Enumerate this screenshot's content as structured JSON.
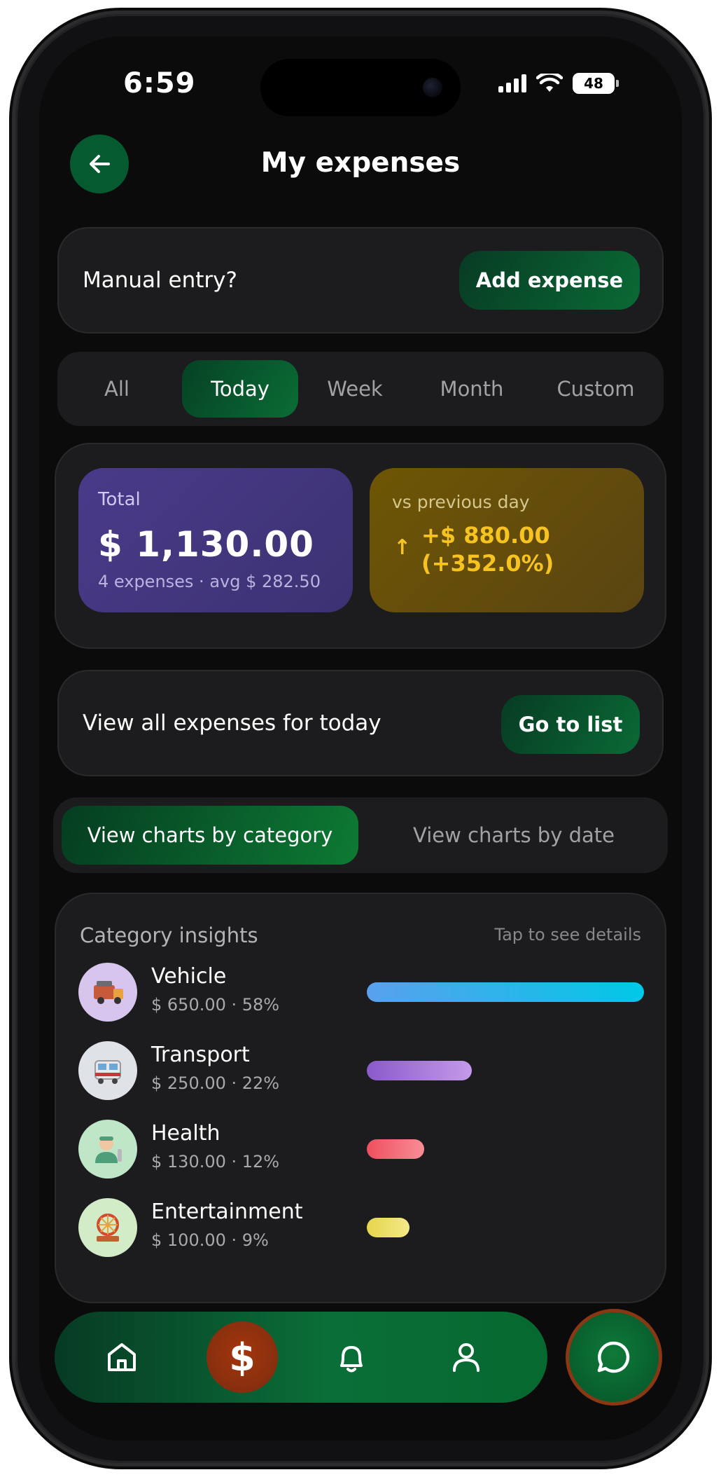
{
  "status_bar": {
    "time": "6:59",
    "battery": "48"
  },
  "header": {
    "title": "My expenses"
  },
  "manual_entry": {
    "label": "Manual entry?",
    "button": "Add expense"
  },
  "periods": {
    "items": [
      "All",
      "Today",
      "Week",
      "Month",
      "Custom"
    ],
    "selected": "Today"
  },
  "summary": {
    "total_label": "Total",
    "total_value": "$ 1,130.00",
    "total_meta": "4 expenses · avg $ 282.50",
    "delta_label": "vs previous day",
    "delta_arrow": "↑",
    "delta_amount": "+$ 880.00",
    "delta_percent": "(+352.0%)"
  },
  "view_all": {
    "label": "View all expenses for today",
    "button": "Go to list"
  },
  "chart_toggle": {
    "options": [
      "View charts by category",
      "View charts by date"
    ],
    "selected": "View charts by category"
  },
  "insights": {
    "title": "Category insights",
    "hint": "Tap to see details",
    "categories": [
      {
        "name": "Vehicle",
        "amount": "$ 650.00 · 58%",
        "share": 0.58,
        "icon": "truck-icon",
        "avatar_color": "#d8c5ee",
        "bar_colors": [
          "#5aa0ee",
          "#00c8e6"
        ]
      },
      {
        "name": "Transport",
        "amount": "$ 250.00 · 22%",
        "share": 0.22,
        "icon": "tram-icon",
        "avatar_color": "#dfe2e6",
        "bar_colors": [
          "#8a5acb",
          "#c49ae9"
        ]
      },
      {
        "name": "Health",
        "amount": "$ 130.00 · 12%",
        "share": 0.12,
        "icon": "doctor-icon",
        "avatar_color": "#bfe6c7",
        "bar_colors": [
          "#ef4f5f",
          "#f88d96"
        ]
      },
      {
        "name": "Entertainment",
        "amount": "$ 100.00 · 9%",
        "share": 0.09,
        "icon": "carousel-icon",
        "avatar_color": "#d3ecc8",
        "bar_colors": [
          "#e6d54a",
          "#f3e98a"
        ]
      }
    ]
  },
  "bottom_nav": {
    "items": [
      "home-icon",
      "dollar-icon",
      "bell-icon",
      "user-icon"
    ],
    "dollar_glyph": "$",
    "chat": "chat-icon"
  },
  "colors": {
    "accent_green": "#0a6d35",
    "delta_yellow": "#f7c320",
    "total_purple": "#4a3a8a",
    "dollar_orange": "#a4360e"
  }
}
